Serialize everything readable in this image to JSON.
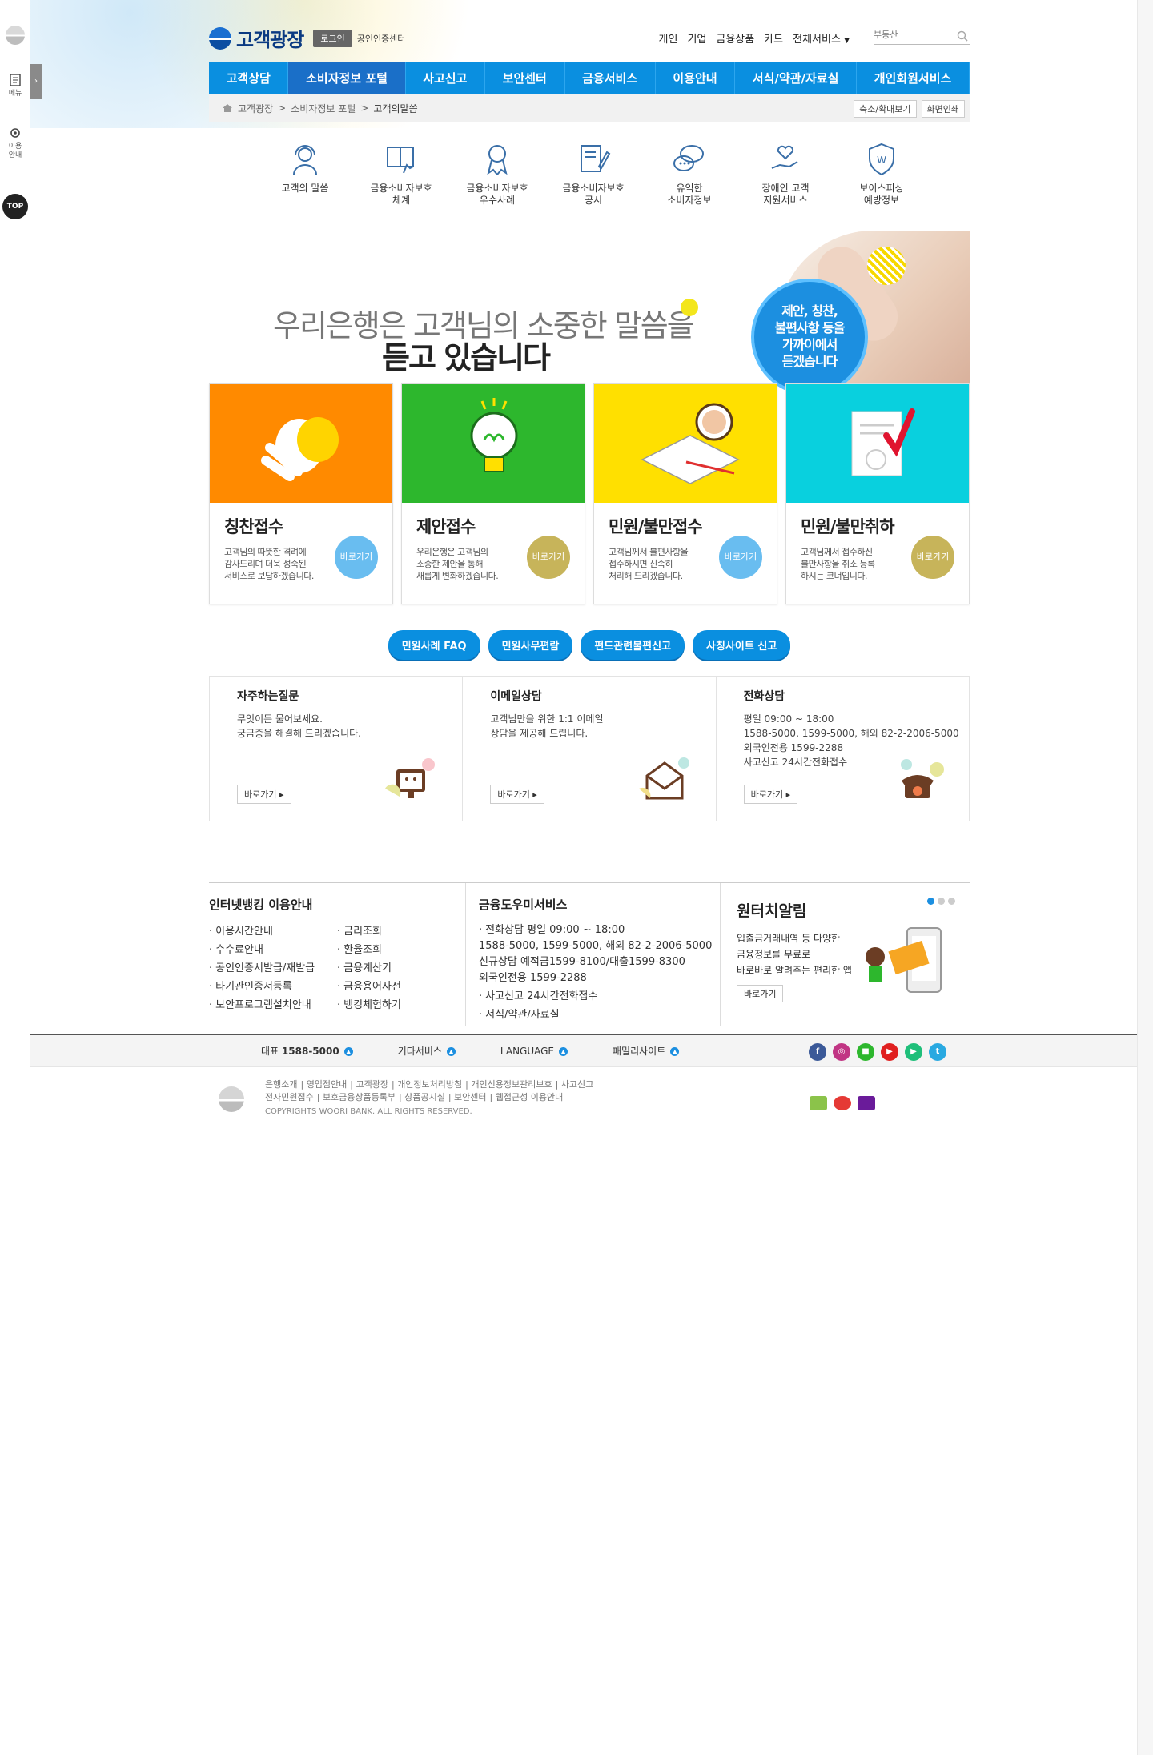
{
  "quick": {
    "menu": "메뉴",
    "guide": "이용\n안내",
    "top": "TOP",
    "toggle": "›"
  },
  "header": {
    "brand": "고객광장",
    "login": "로그인",
    "cert": "공인인증센터",
    "util": [
      "개인",
      "기업",
      "금융상품",
      "카드",
      "전체서비스"
    ],
    "search_placeholder": "부동산"
  },
  "gnb": [
    "고객상담",
    "소비자정보 포털",
    "사고신고",
    "보안센터",
    "금융서비스",
    "이용안내",
    "서식/약관/자료실",
    "개인회원서비스"
  ],
  "breadcrumb": {
    "home": "고객광장",
    "sep": ">",
    "mid": "소비자정보 포털",
    "current": "고객의말씀",
    "zoom": "축소/확대보기",
    "print": "화면인쇄"
  },
  "subnav": [
    {
      "label": "고객의 말씀",
      "icon": "headset-icon"
    },
    {
      "label": "금융소비자보호\n체계",
      "icon": "book-hand-icon"
    },
    {
      "label": "금융소비자보호\n우수사례",
      "icon": "award-icon"
    },
    {
      "label": "금융소비자보호\n공시",
      "icon": "document-pen-icon"
    },
    {
      "label": "유익한\n소비자정보",
      "icon": "chat-bubbles-icon"
    },
    {
      "label": "장애인 고객\n지원서비스",
      "icon": "heart-hand-icon"
    },
    {
      "label": "보이스피싱\n예방정보",
      "icon": "shield-icon"
    }
  ],
  "hero": {
    "line1": "우리은행은 고객님의 소중한 말씀을",
    "line2": "듣고 있습니다",
    "bubble": "제안, 칭찬,\n불편사항 등을\n가까이에서\n듣겠습니다"
  },
  "cards": [
    {
      "title": "칭찬접수",
      "desc": "고객님의 따뜻한 격려에\n감사드리며 더욱 성숙된\n서비스로 보답하겠습니다.",
      "go": "바로가기",
      "color": "#ff8a00",
      "gocolor": "#69bdf0"
    },
    {
      "title": "제안접수",
      "desc": "우리은행은 고객님의\n소중한 제안을 통해\n새롭게 변화하겠습니다.",
      "go": "바로가기",
      "color": "#2db72d",
      "gocolor": "#c7b45a"
    },
    {
      "title": "민원/불만접수",
      "desc": "고객님께서 불편사항을\n접수하시면 신속히\n처리해 드리겠습니다.",
      "go": "바로가기",
      "color": "#ffe000",
      "gocolor": "#69bdf0"
    },
    {
      "title": "민원/불만취하",
      "desc": "고객님께서 접수하신\n불만사항을 취소 등록\n하시는 코너입니다.",
      "go": "바로가기",
      "color": "#09d0de",
      "gocolor": "#c7b45a"
    }
  ],
  "pills": [
    "민원사례 FAQ",
    "민원사무편람",
    "펀드관련불편신고",
    "사칭사이트 신고"
  ],
  "consult": [
    {
      "title": "자주하는질문",
      "text": "무엇이든 물어보세요.\n궁금증을 해결해 드리겠습니다.",
      "btn": "바로가기 ▸"
    },
    {
      "title": "이메일상담",
      "text": "고객님만을 위한 1:1 이메일\n상담을 제공해 드립니다.",
      "btn": "바로가기 ▸"
    },
    {
      "title": "전화상담",
      "text": "평일 09:00 ~ 18:00\n1588-5000, 1599-5000, 해외 82-2-2006-5000\n외국인전용 1599-2288\n사고신고 24시간전화접수",
      "btn": "바로가기 ▸"
    }
  ],
  "info": {
    "title1": "인터넷뱅킹 이용안내",
    "col1": [
      "이용시간안내",
      "수수료안내",
      "공인인증서발급/재발급",
      "타기관인증서등록",
      "보안프로그램설치안내"
    ],
    "col2": [
      "금리조회",
      "환율조회",
      "금융계산기",
      "금융용어사전",
      "뱅킹체험하기"
    ],
    "title2": "금융도우미서비스",
    "list2": [
      "전화상담 평일 09:00 ~ 18:00\n1588-5000, 1599-5000, 해외 82-2-2006-5000\n신규상담 예적금1599-8100/대출1599-8300\n외국인전용 1599-2288",
      "사고신고 24시간전화접수",
      "서식/약관/자료실"
    ],
    "title3": "원터치알림",
    "text3": "입출금거래내역 등 다양한\n금융정보를 무료로\n바로바로 알려주는 편리한 앱",
    "btn3": "바로가기"
  },
  "footbar": {
    "rep_label": "대표",
    "rep_number": "1588-5000",
    "other": "기타서비스",
    "language": "LANGUAGE",
    "family": "패밀리사이트"
  },
  "footer": {
    "links1": [
      "은행소개",
      "영업점안내",
      "고객광장",
      "개인정보처리방침",
      "개인신용정보관리보호",
      "사고신고"
    ],
    "links2": [
      "전자민원접수",
      "보호금융상품등록부",
      "상품공시실",
      "보안센터",
      "웹접근성 이용안내"
    ],
    "copy": "COPYRIGHTS WOORI BANK. ALL RIGHTS RESERVED."
  }
}
